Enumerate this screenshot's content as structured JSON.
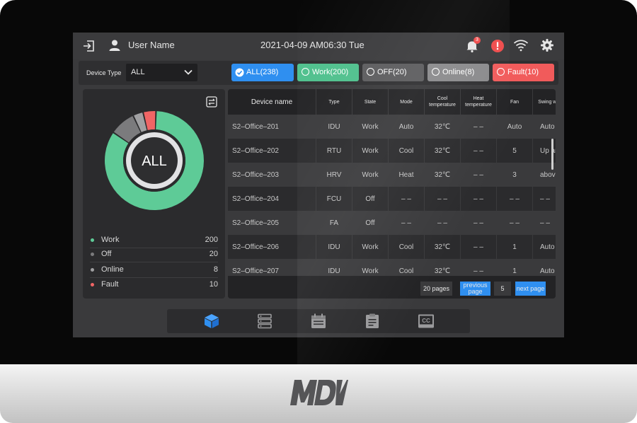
{
  "brand": {
    "logo_text": "MDV"
  },
  "status_bar": {
    "user_name": "User Name",
    "datetime": "2021-04-09 AM06:30 Tue",
    "notification_count": "3",
    "icons": [
      "logout-icon",
      "user-icon",
      "bell-icon",
      "alert-icon",
      "wifi-icon",
      "gear-icon"
    ]
  },
  "filter": {
    "device_type_label": "Device Type",
    "device_type_value": "ALL",
    "chips": [
      {
        "label": "ALL(238)",
        "color": "#2f8ff0",
        "selected": true
      },
      {
        "label": "Work(200)",
        "color": "#4fc08d",
        "selected": false
      },
      {
        "label": "OFF(20)",
        "color": "#5c5c5e",
        "selected": false
      },
      {
        "label": "Online(8)",
        "color": "#8a8a8c",
        "selected": false
      },
      {
        "label": "Fault(10)",
        "color": "#f15b5b",
        "selected": false
      }
    ]
  },
  "summary": {
    "center_label": "ALL",
    "legend": [
      {
        "label": "Work",
        "count": "200",
        "color": "#5ecb97"
      },
      {
        "label": "Off",
        "count": "20",
        "color": "#7b7b7d"
      },
      {
        "label": "Online",
        "count": "8",
        "color": "#a0a0a2"
      },
      {
        "label": "Fault",
        "count": "10",
        "color": "#f06565"
      }
    ]
  },
  "chart_data": {
    "type": "pie",
    "categories": [
      "Work",
      "Off",
      "Online",
      "Fault"
    ],
    "values": [
      200,
      20,
      8,
      10
    ],
    "colors": [
      "#5ecb97",
      "#7b7b7d",
      "#a0a0a2",
      "#f06565"
    ]
  },
  "table": {
    "columns": [
      "Device name",
      "Type",
      "State",
      "Mode",
      "Cool temperature",
      "Heat temperature",
      "Fan",
      "Swing wind"
    ],
    "rows": [
      [
        "S2–Office–201",
        "IDU",
        "Work",
        "Auto",
        "32℃",
        "– –",
        "Auto",
        "Auto"
      ],
      [
        "S2–Office–202",
        "RTU",
        "Work",
        "Cool",
        "32℃",
        "– –",
        "5",
        "Up and down"
      ],
      [
        "S2–Office–203",
        "HRV",
        "Work",
        "Heat",
        "32℃",
        "– –",
        "3",
        "above"
      ],
      [
        "S2–Office–204",
        "FCU",
        "Off",
        "– –",
        "– –",
        "– –",
        "– –",
        "– –"
      ],
      [
        "S2–Office–205",
        "FA",
        "Off",
        "– –",
        "– –",
        "– –",
        "– –",
        "– –"
      ],
      [
        "S2–Office–206",
        "IDU",
        "Work",
        "Cool",
        "32℃",
        "– –",
        "1",
        "Auto"
      ],
      [
        "S2–Office–207",
        "IDU",
        "Work",
        "Cool",
        "32℃",
        "– –",
        "1",
        "Auto"
      ]
    ]
  },
  "pagination": {
    "total_pages": "20 pages",
    "previous_label": "previous page",
    "current_page": "5",
    "next_label": "next page"
  },
  "nav": {
    "items": [
      "devices-icon",
      "list-icon",
      "schedule-icon",
      "report-icon",
      "cc-icon"
    ],
    "cc_text": "CC",
    "active_color": "#2f8ff0"
  }
}
